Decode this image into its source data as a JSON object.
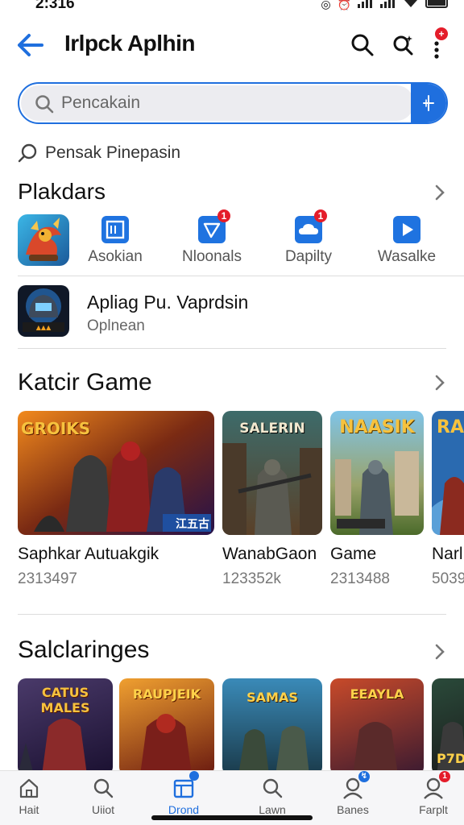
{
  "status_bar": {
    "time": "2:316"
  },
  "app_bar": {
    "title": "Irlpck Aplhin"
  },
  "search": {
    "placeholder": "Pencakain"
  },
  "suggestion": {
    "text": "Pensak Pinepasin"
  },
  "categories_section": {
    "title": "Plakdars",
    "items": [
      {
        "label": "Asokian",
        "icon": "grid-square-icon"
      },
      {
        "label": "Nloonals",
        "icon": "send-icon"
      },
      {
        "label": "Dapilty",
        "icon": "cloud-icon"
      },
      {
        "label": "Wasalke",
        "icon": "play-icon"
      }
    ]
  },
  "featured_app": {
    "name": "Apliag Pu. Vaprdsin",
    "subtitle": "Oplnean"
  },
  "games_section": {
    "title": "Katcir Game",
    "cards": [
      {
        "title": "Saphkar Autuakgik",
        "count": "2313497",
        "banner": "GROIKS",
        "badge": "江五古"
      },
      {
        "title": "WanabGaon",
        "count": "123352k",
        "banner": "SALERIN"
      },
      {
        "title": "Game",
        "count": "2313488",
        "banner": "NAASIK"
      },
      {
        "title": "Narl",
        "count": "5039",
        "banner": "RA"
      }
    ]
  },
  "second_section": {
    "title": "Salclaringes",
    "banners": [
      "CATUS MALES",
      "RAUPJEIK",
      "SAMAS",
      "EEAYLA",
      "P7D"
    ]
  },
  "bottom_nav": {
    "items": [
      {
        "label": "Hait"
      },
      {
        "label": "Uiiot"
      },
      {
        "label": "Drond"
      },
      {
        "label": "Lawn"
      },
      {
        "label": "Banes"
      },
      {
        "label": "Farplt"
      }
    ]
  },
  "colors": {
    "accent": "#1f6fde",
    "badge": "#e41d2a"
  }
}
